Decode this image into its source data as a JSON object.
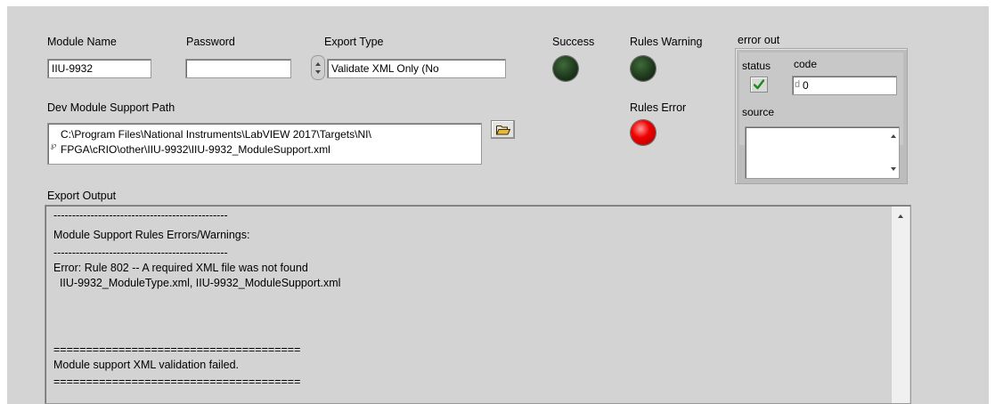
{
  "module_name": {
    "label": "Module Name",
    "value": "IIU-9932"
  },
  "password": {
    "label": "Password",
    "value": ""
  },
  "export_type": {
    "label": "Export Type",
    "value": "Validate XML Only (No"
  },
  "success": {
    "label": "Success",
    "state": "off",
    "color": "#1f3a1c"
  },
  "rules_warning": {
    "label": "Rules Warning",
    "state": "off",
    "color": "#1f3a1c"
  },
  "rules_error": {
    "label": "Rules Error",
    "state": "on",
    "color": "#f00000"
  },
  "dev_path": {
    "label": "Dev Module Support Path",
    "line1": "C:\\Program Files\\National Instruments\\LabVIEW 2017\\Targets\\NI\\",
    "line2": "FPGA\\cRIO\\other\\IIU-9932\\IIU-9932_ModuleSupport.xml",
    "browse_icon": "folder-open-icon"
  },
  "error_out": {
    "label": "error out",
    "status_label": "status",
    "status_icon": "checkmark-icon",
    "code_label": "code",
    "code_radix": "d",
    "code_value": "0",
    "source_label": "source",
    "source_value": ""
  },
  "export_output": {
    "label": "Export Output",
    "lines": [
      "-----------------------------------------------",
      "Module Support Rules Errors/Warnings:",
      "-----------------------------------------------",
      "Error: Rule 802 -- A required XML file was not found",
      "  IIU-9932_ModuleType.xml, IIU-9932_ModuleSupport.xml",
      "",
      "",
      "",
      "======================================",
      "Module support XML validation failed.",
      "======================================"
    ]
  }
}
